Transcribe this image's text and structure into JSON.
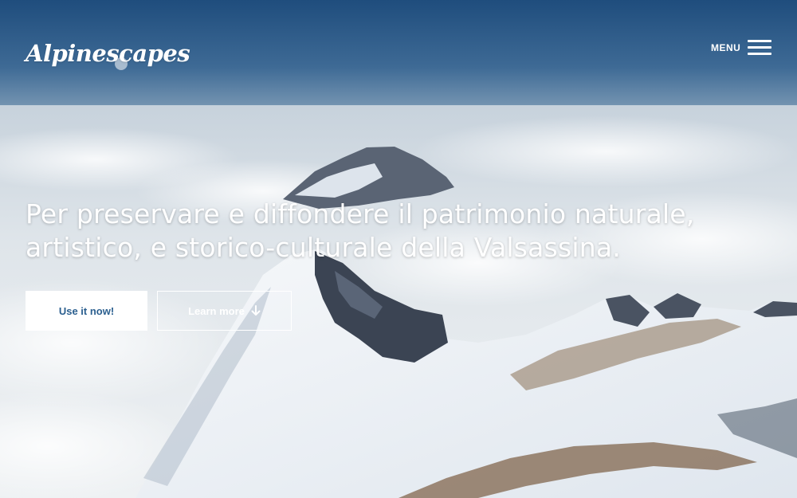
{
  "brand": {
    "name": "Alpinescapes"
  },
  "nav": {
    "menu_label": "MENU",
    "menu_icon": "hamburger-icon"
  },
  "hero": {
    "headline_line1": "Per preservare e diffondere il patrimonio naturale,",
    "headline_line2": "artistico, e storico-culturale della Valsassina.",
    "primary_cta": "Use it now!",
    "secondary_cta": "Learn more",
    "secondary_cta_icon": "arrow-down-icon"
  },
  "colors": {
    "sky_top": "#1f4f80",
    "sky_horizon": "#6f93b3",
    "cloud": "#e3e8ec",
    "snow": "#f2f5f8",
    "rock": "#3d4656",
    "primary_text": "#2b5f8f",
    "white": "#ffffff"
  }
}
